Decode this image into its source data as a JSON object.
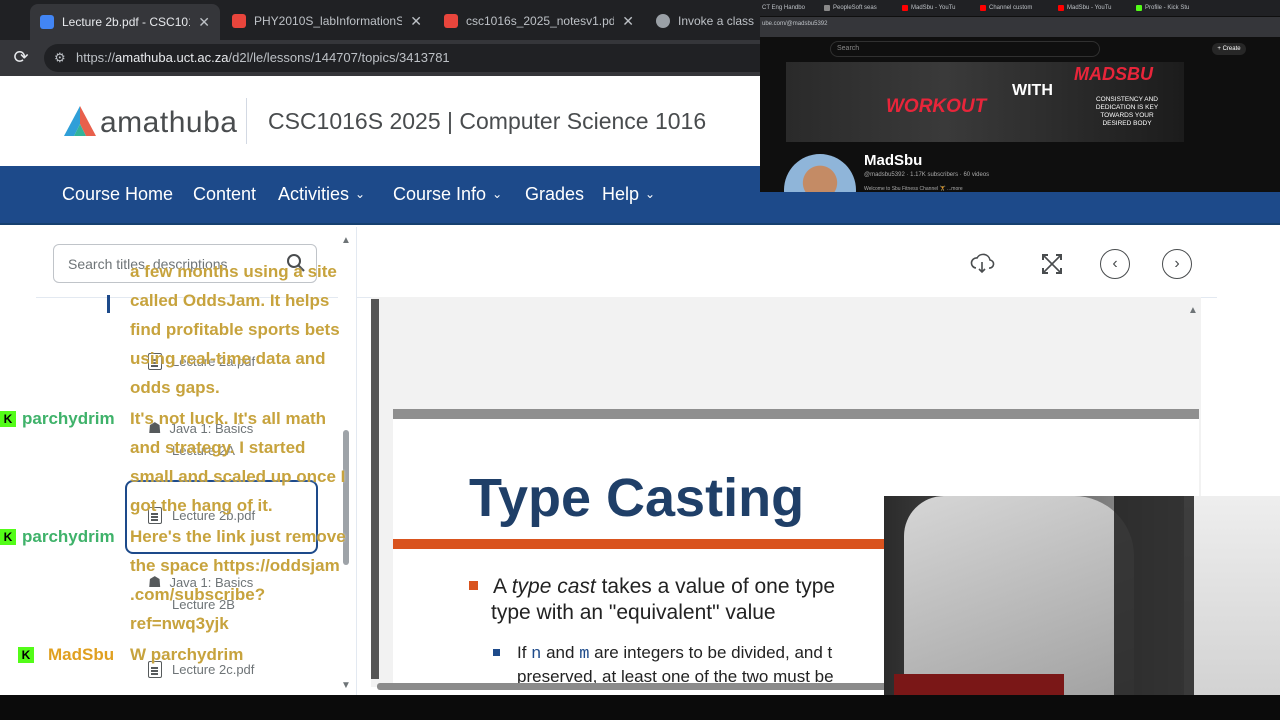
{
  "browser": {
    "tabs": [
      {
        "label": "Lecture 2b.pdf - CSC1016S 20",
        "active": true,
        "color": "#4285f4"
      },
      {
        "label": "PHY2010S_labInformationShe",
        "active": false,
        "color": "#e8453c"
      },
      {
        "label": "csc1016s_2025_notesv1.pdf",
        "active": false,
        "color": "#e8453c"
      },
      {
        "label": "Invoke a class in",
        "active": false,
        "color": "#9aa0a6"
      }
    ],
    "url_prefix": "https://",
    "url_host": "amathuba.uct.ac.za",
    "url_path": "/d2l/le/lessons/144707/topics/3413781"
  },
  "header": {
    "logo_text": "amathuba",
    "course_title": "CSC1016S 2025 | Computer Science 1016"
  },
  "nav": [
    {
      "label": "Course Home",
      "dropdown": false
    },
    {
      "label": "Content",
      "dropdown": false
    },
    {
      "label": "Activities",
      "dropdown": true
    },
    {
      "label": "Course Info",
      "dropdown": true
    },
    {
      "label": "Grades",
      "dropdown": false
    },
    {
      "label": "Help",
      "dropdown": true
    }
  ],
  "toc": {
    "search_placeholder": "Search titles, descriptions",
    "items": [
      {
        "label": "Lecture 2a.pdf",
        "icon": "document-icon"
      },
      {
        "label": "Java 1: Basics",
        "icon": "activity-icon"
      },
      {
        "label": "Lecture 2A",
        "icon": "none"
      },
      {
        "label": "Lecture 2b.pdf",
        "icon": "document-icon"
      },
      {
        "label": "Java 1: Basics",
        "icon": "activity-icon"
      },
      {
        "label": "Lecture 2B",
        "icon": "none"
      },
      {
        "label": "Lecture 2c.pdf",
        "icon": "document-icon"
      }
    ]
  },
  "viewer": {
    "tools": [
      "download-icon",
      "fullscreen-icon",
      "previous-icon",
      "next-icon"
    ]
  },
  "slide": {
    "title": "Type Casting",
    "bullet1_pre": "A ",
    "bullet1_em": "type cast",
    "bullet1_post": " takes a value of one type",
    "bullet1_line2": "type with an \"equivalent\" value",
    "bullet2_pre": "If ",
    "bullet2_n": "n",
    "bullet2_and": " and ",
    "bullet2_m": "m",
    "bullet2_post": " are integers to be divided, and t",
    "bullet2_line2": "preserved, at least one of the two must be",
    "accent_color": "#d9531e",
    "title_color": "#1f3f68"
  },
  "chat": {
    "lines": [
      {
        "text": "a few months using a site",
        "kind": "msg"
      },
      {
        "text": "called OddsJam. It helps",
        "kind": "msg"
      },
      {
        "text": "find profitable sports bets",
        "kind": "msg"
      },
      {
        "text": "using real-time data and",
        "kind": "msg"
      },
      {
        "text": "odds gaps.",
        "kind": "msg"
      },
      {
        "text": "It's not luck. It's all math",
        "kind": "msg"
      },
      {
        "text": "and strategy. I started",
        "kind": "msg"
      },
      {
        "text": "small and scaled up once I",
        "kind": "msg"
      },
      {
        "text": "got the hang of it.",
        "kind": "msg"
      },
      {
        "text": "Here's the link just remove",
        "kind": "msg"
      },
      {
        "text": "the space https://oddsjam",
        "kind": "msg"
      },
      {
        "text": ".com/subscribe?",
        "kind": "msg"
      },
      {
        "text": "ref=nwq3yjk",
        "kind": "msg"
      },
      {
        "text": "W parchydrim",
        "kind": "msg"
      }
    ],
    "users": [
      {
        "name": "parchydrim",
        "kind": "p"
      },
      {
        "name": "parchydrim",
        "kind": "p"
      },
      {
        "name": "MadSbu",
        "kind": "m"
      }
    ]
  },
  "youtube": {
    "tabs": [
      "CT Eng Handbo",
      "PeopleSoft seas",
      "MadSbu - YouTu",
      "Channel custom",
      "MadSbu - YouTu",
      "Profile - Kick Stu"
    ],
    "url": "ube.com/@madsbu5392",
    "search_placeholder": "Search",
    "create_label": "+ Create",
    "banner_workout": "WORKOUT",
    "banner_with": "WITH",
    "banner_madsbu": "MADSBU",
    "banner_tagline": "CONSISTENCY AND DEDICATION IS KEY TOWARDS YOUR DESIRED BODY",
    "channel_name": "MadSbu",
    "channel_meta": "@madsbu5392 · 1.17K subscribers · 60 videos",
    "channel_desc": "Welcome to Sbu Fitness Channel 🏋 ...more"
  }
}
